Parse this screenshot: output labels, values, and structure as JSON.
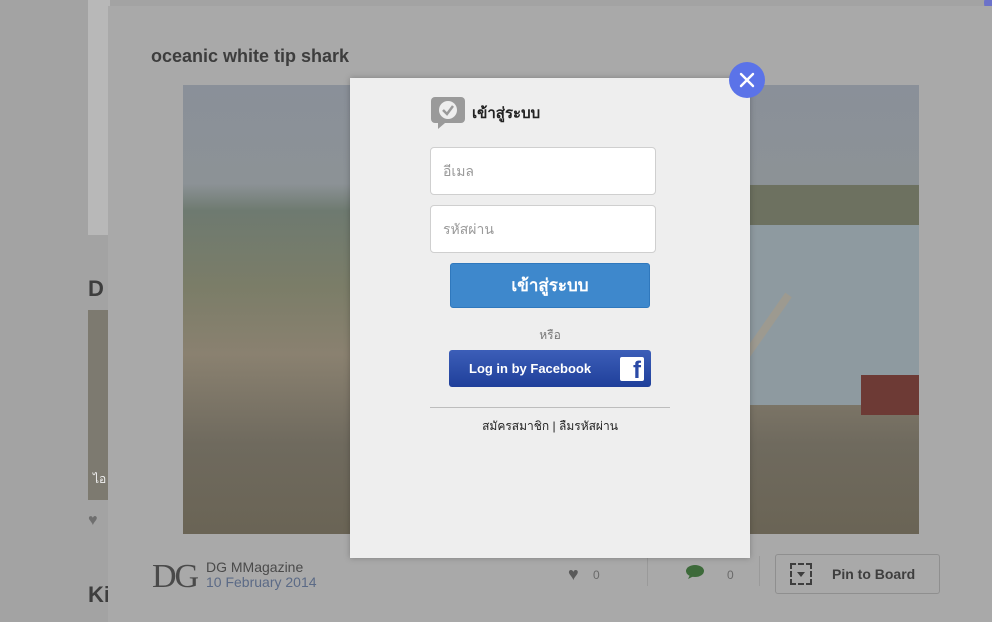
{
  "background": {
    "left_heading_1": "D",
    "left_heading_2": "Ki",
    "left_caption": "ไอ"
  },
  "card": {
    "title": "oceanic white tip shark",
    "author": {
      "logo_text": "DG",
      "name": "DG MMagazine",
      "date": "10 February 2014"
    },
    "likes": "0",
    "comments": "0",
    "pin_label": "Pin to Board",
    "icons": [
      "heart-icon",
      "comment-icon",
      "pin-board-icon"
    ]
  },
  "modal": {
    "title": "เข้าสู่ระบบ",
    "email_placeholder": "อีเมล",
    "password_placeholder": "รหัสผ่าน",
    "login_button": "เข้าสู่ระบบ",
    "or_text": "หรือ",
    "facebook_button": "Log in by Facebook",
    "register_link": "สมัครสมาชิก",
    "separator": " | ",
    "forgot_link": "ลืมรหัสผ่าน",
    "icons": [
      "chat-check-icon",
      "facebook-icon",
      "close-icon"
    ]
  },
  "colors": {
    "overlay": "#a9a9a9",
    "modal_bg": "#eeeeee",
    "login_button": "#3e88cc",
    "facebook_button": "#2b4aa6",
    "close_button": "#5b73e8"
  }
}
